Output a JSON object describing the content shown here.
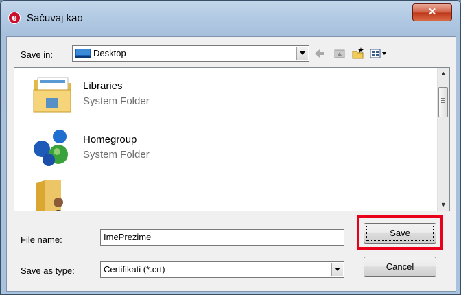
{
  "window": {
    "title": "Sačuvaj kao",
    "app_icon_letter": "e",
    "close_symbol": "✕"
  },
  "toolbar": {
    "save_in_label": "Save in:",
    "location": "Desktop",
    "icons": [
      "back-arrow-icon",
      "up-folder-icon",
      "new-folder-icon",
      "view-menu-icon"
    ]
  },
  "files": [
    {
      "name": "Libraries",
      "type": "System Folder",
      "icon": "libraries-folder-icon"
    },
    {
      "name": "Homegroup",
      "type": "System Folder",
      "icon": "homegroup-icon"
    },
    {
      "name": "",
      "type": "",
      "icon": "user-folder-icon"
    }
  ],
  "form": {
    "file_name_label": "File name:",
    "file_name_value": "ImePrezime",
    "save_as_type_label": "Save as type:",
    "save_as_type_value": "Certifikati (*.crt)",
    "save_button": "Save",
    "cancel_button": "Cancel"
  },
  "colors": {
    "highlight": "#e8001c",
    "close_button": "#c0391c"
  }
}
